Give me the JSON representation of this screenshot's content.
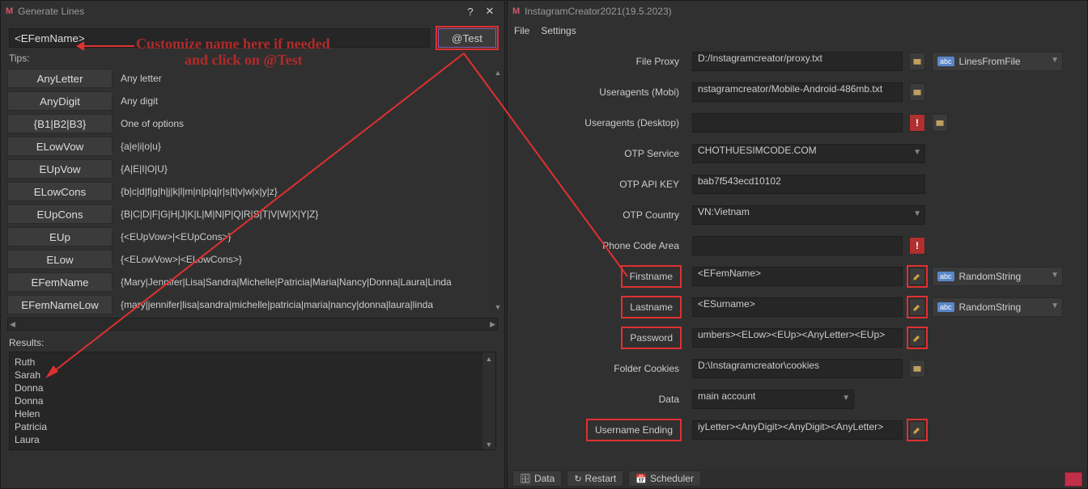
{
  "left": {
    "title": "Generate Lines",
    "name_value": "<EFemName>",
    "test_label": "@Test",
    "tips_label": "Tips:",
    "annotation_line1": "Customize name here if needed",
    "annotation_line2": "and click on @Test",
    "tips": [
      {
        "name": "AnyLetter",
        "desc": "Any letter"
      },
      {
        "name": "AnyDigit",
        "desc": "Any digit"
      },
      {
        "name": "{B1|B2|B3}",
        "desc": "One of options"
      },
      {
        "name": "ELowVow",
        "desc": "{a|e|i|o|u}"
      },
      {
        "name": "EUpVow",
        "desc": "{A|E|I|O|U}"
      },
      {
        "name": "ELowCons",
        "desc": "{b|c|d|f|g|h|j|k|l|m|n|p|q|r|s|t|v|w|x|y|z}"
      },
      {
        "name": "EUpCons",
        "desc": "{B|C|D|F|G|H|J|K|L|M|N|P|Q|R|S|T|V|W|X|Y|Z}"
      },
      {
        "name": "EUp",
        "desc": "{<EUpVow>|<EUpCons>}"
      },
      {
        "name": "ELow",
        "desc": "{<ELowVow>|<ELowCons>}"
      },
      {
        "name": "EFemName",
        "desc": "{Mary|Jennifer|Lisa|Sandra|Michelle|Patricia|Maria|Nancy|Donna|Laura|Linda"
      },
      {
        "name": "EFemNameLow",
        "desc": "{mary|jennifer|lisa|sandra|michelle|patricia|maria|nancy|donna|laura|linda"
      }
    ],
    "results_label": "Results:",
    "results": [
      "Ruth",
      "Sarah",
      "Donna",
      "Donna",
      "Helen",
      "Patricia",
      "Laura"
    ]
  },
  "right": {
    "title": "InstagramCreator2021(19.5.2023)",
    "menu": {
      "file": "File",
      "settings": "Settings"
    },
    "rows": {
      "file_proxy": {
        "label": "File Proxy",
        "value": "D:/Instagramcreator/proxy.txt",
        "type": "LinesFromFile"
      },
      "useragents_mobi": {
        "label": "Useragents (Mobi)",
        "value": "nstagramcreator/Mobile-Android-486mb.txt"
      },
      "useragents_desktop": {
        "label": "Useragents (Desktop)",
        "value": ""
      },
      "otp_service": {
        "label": "OTP Service",
        "value": "CHOTHUESIMCODE.COM"
      },
      "otp_api_key": {
        "label": "OTP API KEY",
        "value": "bab7f543ecd10102"
      },
      "otp_country": {
        "label": "OTP Country",
        "value": "VN:Vietnam"
      },
      "phone_code_area": {
        "label": "Phone Code Area",
        "value": ""
      },
      "firstname": {
        "label": "Firstname",
        "value": "<EFemName>",
        "type": "RandomString"
      },
      "lastname": {
        "label": "Lastname",
        "value": "<ESurname>",
        "type": "RandomString"
      },
      "password": {
        "label": "Password",
        "value": "umbers><ELow><EUp><AnyLetter><EUp>"
      },
      "folder_cookies": {
        "label": "Folder Cookies",
        "value": "D:\\Instagramcreator\\cookies"
      },
      "data": {
        "label": "Data",
        "value": "main account"
      },
      "username_ending": {
        "label": "Username Ending",
        "value": "iyLetter><AnyDigit><AnyDigit><AnyLetter>"
      }
    },
    "bottom": {
      "data": "Data",
      "restart": "Restart",
      "scheduler": "Scheduler"
    }
  }
}
